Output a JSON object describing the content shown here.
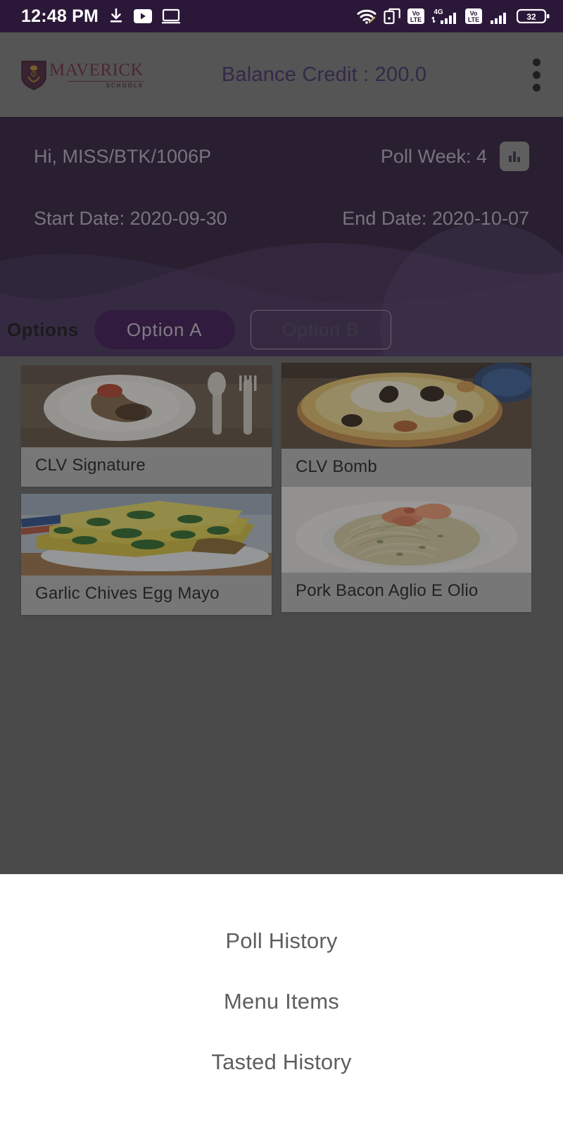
{
  "statusbar": {
    "time": "12:48 PM",
    "left_icons": [
      "download-icon",
      "youtube-icon",
      "screen-icon"
    ],
    "right_icons": [
      "wifi-icon",
      "cast-icon",
      "volte-icon",
      "signal-4g-icon",
      "volte-icon-2",
      "signal-icon-2",
      "battery-icon"
    ],
    "network_label": "4G",
    "volte_label_top": "Vo",
    "volte_label_bottom": "LTE",
    "battery_level": "32",
    "bg_color": "#2B1839"
  },
  "appbar": {
    "logo_main": "MAVERICK",
    "logo_sub": "SCHOOLS",
    "logo_icon": "shield-crest-icon",
    "balance_text": "Balance Credit : 200.0",
    "overflow_icon": "kebab-menu-icon",
    "bg_color": "#7a7a7a",
    "balance_color": "#3d2a63"
  },
  "hero": {
    "greeting": "Hi, MISS/BTK/1006P",
    "poll_week": "Poll Week: 4",
    "chart_icon": "bar-chart-icon",
    "start_date": "Start Date: 2020-09-30",
    "end_date": "End Date: 2020-10-07",
    "bg_color": "#2B1839",
    "text_color": "#b9b2c4"
  },
  "options": {
    "label": "Options",
    "buttons": [
      {
        "label": "Option A",
        "selected": true
      },
      {
        "label": "Option B",
        "selected": false
      }
    ],
    "selected_bg": "#3a1250"
  },
  "menu_grid": {
    "cards": [
      {
        "name": "CLV Signature",
        "image": "plate-with-sauce-and-cutlery-photo"
      },
      {
        "name": "CLV Bomb",
        "image": "pizza-photo"
      },
      {
        "name": "Garlic Chives Egg Mayo",
        "image": "egg-omelette-slices-photo"
      },
      {
        "name": "Pork Bacon Aglio E Olio",
        "image": "pasta-with-shrimp-photo"
      }
    ]
  },
  "bottom_sheet": {
    "items": [
      {
        "label": "Poll History"
      },
      {
        "label": "Menu Items"
      },
      {
        "label": "Tasted History"
      }
    ],
    "bg_color": "#ffffff",
    "text_color": "#5e5e5e"
  }
}
